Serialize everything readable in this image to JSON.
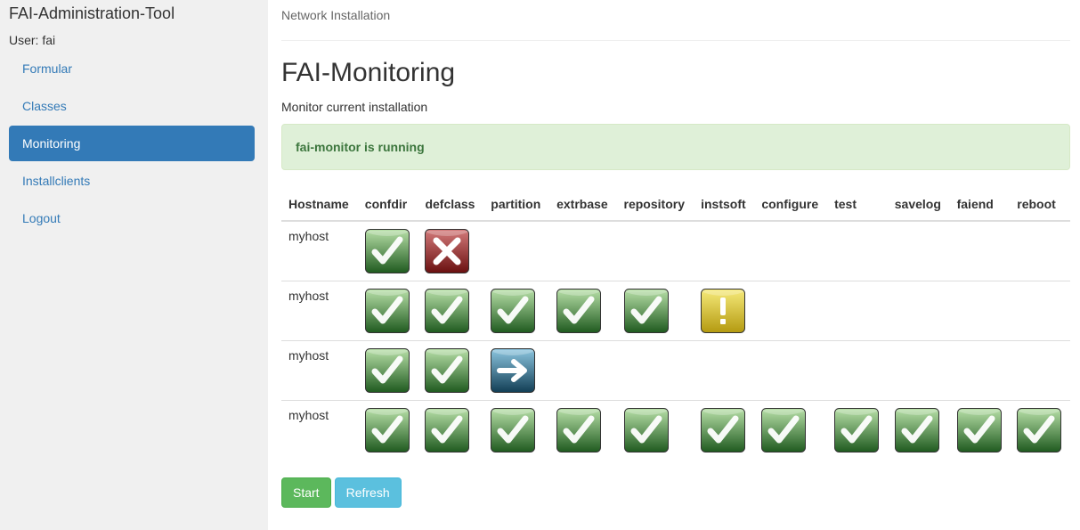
{
  "sidebar": {
    "brand": "FAI-Administration-Tool",
    "user": "User: fai",
    "items": [
      {
        "label": "Formular",
        "active": false
      },
      {
        "label": "Classes",
        "active": false
      },
      {
        "label": "Monitoring",
        "active": true
      },
      {
        "label": "Installclients",
        "active": false
      },
      {
        "label": "Logout",
        "active": false
      }
    ]
  },
  "main": {
    "breadcrumb": "Network Installation",
    "title": "FAI-Monitoring",
    "subtitle": "Monitor current installation",
    "alert": "fai-monitor is running",
    "table": {
      "headers": [
        "Hostname",
        "confdir",
        "defclass",
        "partition",
        "extrbase",
        "repository",
        "instsoft",
        "configure",
        "test",
        "savelog",
        "faiend",
        "reboot"
      ],
      "rows": [
        {
          "hostname": "myhost",
          "status": [
            "success",
            "error",
            "",
            "",
            "",
            "",
            "",
            "",
            "",
            "",
            ""
          ]
        },
        {
          "hostname": "myhost",
          "status": [
            "success",
            "success",
            "success",
            "success",
            "success",
            "warning",
            "",
            "",
            "",
            "",
            ""
          ]
        },
        {
          "hostname": "myhost",
          "status": [
            "success",
            "success",
            "running",
            "",
            "",
            "",
            "",
            "",
            "",
            "",
            ""
          ]
        },
        {
          "hostname": "myhost",
          "status": [
            "success",
            "success",
            "success",
            "success",
            "success",
            "success",
            "success",
            "success",
            "success",
            "success",
            "success"
          ]
        }
      ]
    },
    "buttons": {
      "start": "Start",
      "refresh": "Refresh"
    }
  },
  "colors": {
    "accent": "#337ab7",
    "alert_bg": "#dff0d8",
    "alert_text": "#3c763d",
    "success_btn": "#5cb85c",
    "info_btn": "#5bc0de"
  },
  "icons": {
    "success": "check-icon",
    "error": "x-icon",
    "warning": "exclamation-icon",
    "running": "arrow-right-icon"
  }
}
